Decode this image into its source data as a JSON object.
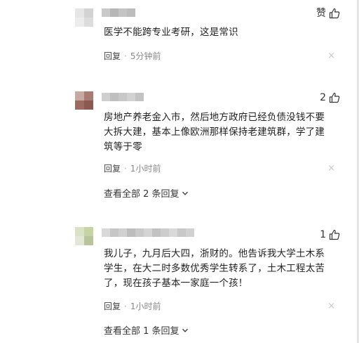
{
  "comments": [
    {
      "text": "医学不能跨专业考研，这是常识",
      "like_label": "赞",
      "reply_label": "回复",
      "separator": "·",
      "time": "5分钟前",
      "close_glyph": "×"
    },
    {
      "text": "房地产养老金入市，然后地方政府已经负债没钱不要大拆大建，基本上像欧洲那样保持老建筑群，学了建筑等于零",
      "like_label": "2",
      "reply_label": "回复",
      "separator": "·",
      "time": "1小时前",
      "close_glyph": "×",
      "view_all": "查看全部 2 条回复"
    },
    {
      "text": "我儿子，九月后大四，浙财的。他告诉我大学土木系学生，在大二时多数优秀学生转系了，土木工程太苦了，现在孩子基本一家庭一个孩！",
      "like_label": "1",
      "reply_label": "回复",
      "separator": "·",
      "time": "1小时前",
      "close_glyph": "×",
      "view_all": "查看全部 1 条回复"
    }
  ],
  "icons": {
    "like": "thumbs-up-icon",
    "close": "close-icon",
    "expand": "chevron-down-icon"
  },
  "colors": {
    "text": "#222222",
    "meta": "#888888",
    "close": "#c8c8c8"
  }
}
